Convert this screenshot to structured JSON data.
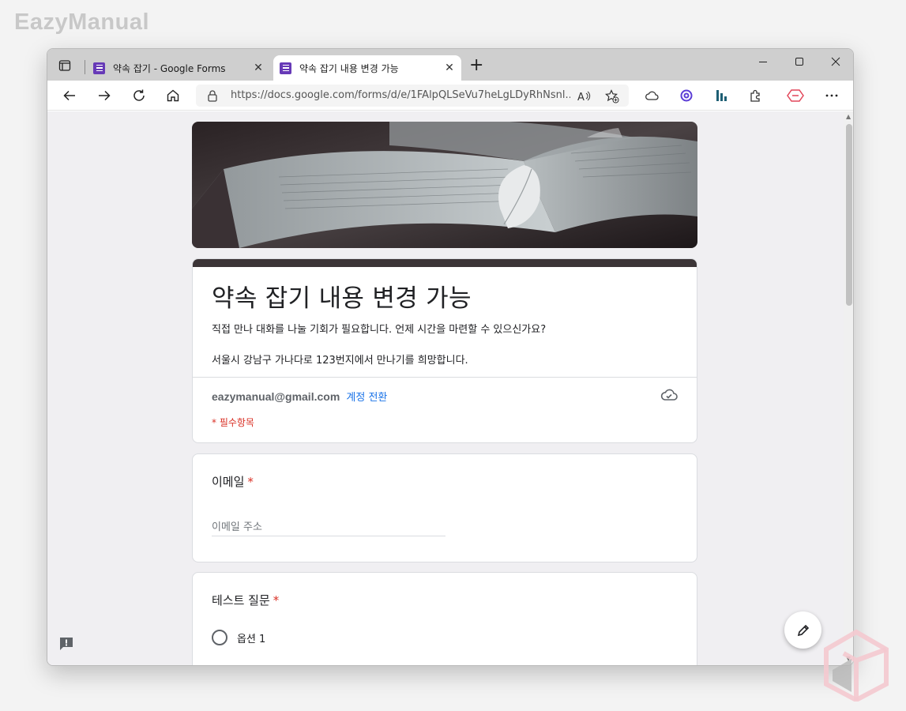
{
  "watermark": {
    "text": "EazyManual"
  },
  "browser": {
    "tabs": [
      {
        "title": "약속 잡기 - Google Forms",
        "active": false
      },
      {
        "title": "약속 잡기 내용 변경 가능",
        "active": true
      }
    ],
    "address_url": "https://docs.google.com/forms/d/e/1FAlpQLSeVu7heLgLDyRhNsnl...",
    "accent_color": "#673ab7"
  },
  "form": {
    "title": "약속 잡기 내용 변경 가능",
    "description_line1": "직접 만나 대화를 나눌 기회가 필요합니다. 언제 시간을 마련할 수 있으신가요?",
    "description_line2": "서울시 강남구 가나다로 123번지에서 만나기를 희망합니다.",
    "account_email": "eazymanual@gmail.com",
    "switch_account": "계정 전환",
    "required_note": "* 필수항목",
    "questions": [
      {
        "label": "이메일",
        "required_mark": "*",
        "placeholder": "이메일 주소"
      },
      {
        "label": "테스트 질문",
        "required_mark": "*",
        "options": [
          "옵션 1"
        ]
      }
    ]
  },
  "colors": {
    "required_red": "#d93025",
    "link_blue": "#1a73e8",
    "form_theme_dark": "#3c3537"
  }
}
